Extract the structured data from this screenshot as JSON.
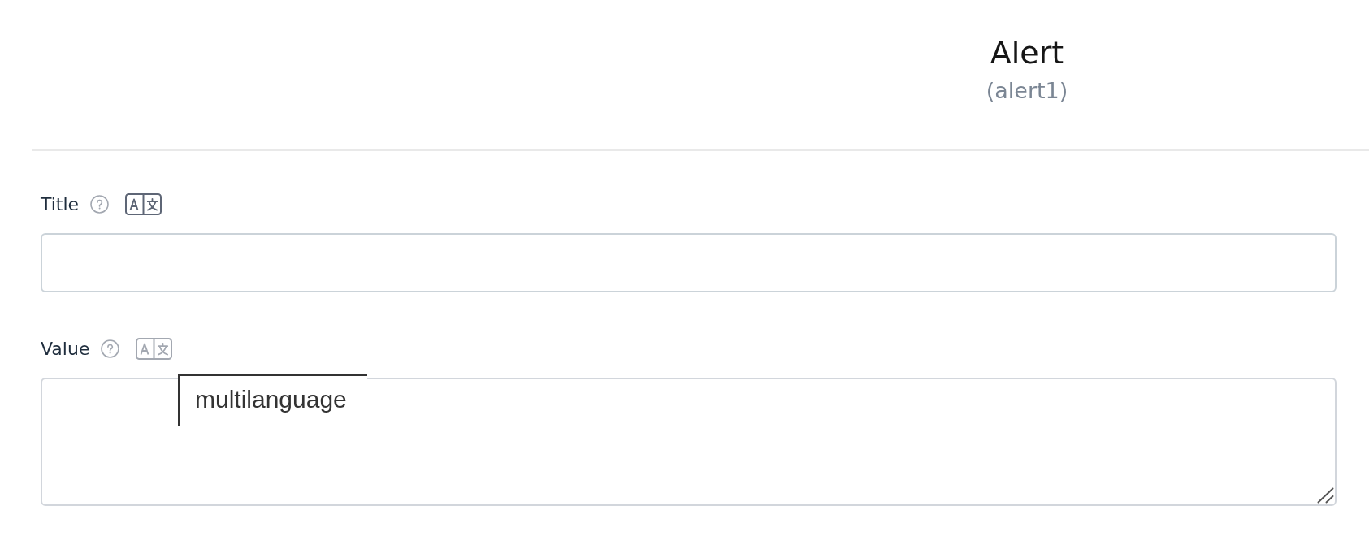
{
  "header": {
    "title": "Alert",
    "subtitle": "(alert1)"
  },
  "fields": [
    {
      "label": "Title",
      "kind": "input",
      "translate_active": true
    },
    {
      "label": "Value",
      "kind": "textarea",
      "translate_active": false,
      "tooltip": "multilanguage"
    }
  ]
}
